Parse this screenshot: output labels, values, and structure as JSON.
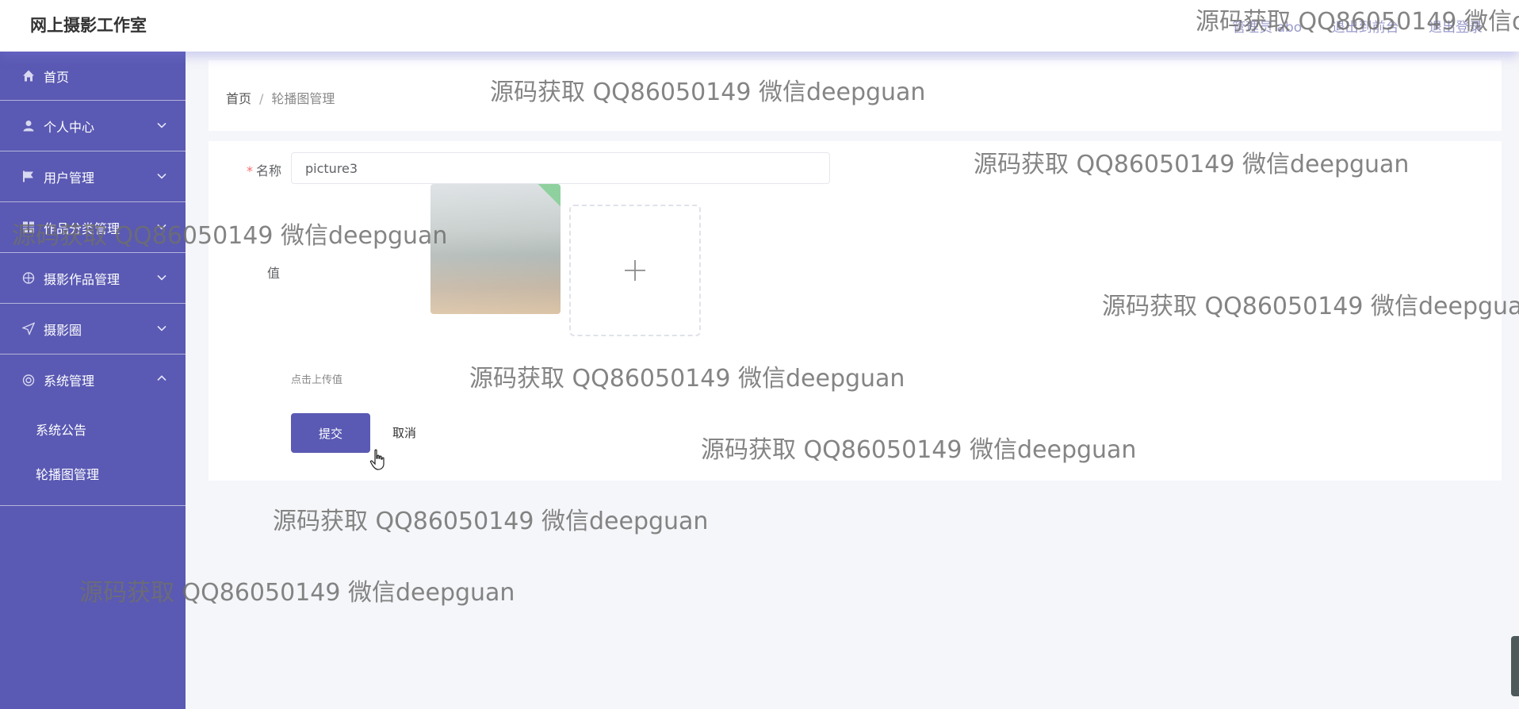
{
  "app": {
    "title": "网上摄影工作室"
  },
  "topbar": {
    "user": "管理员 abo",
    "to_front": "退出到前台",
    "logout": "退出登录"
  },
  "sidebar": {
    "items": [
      {
        "label": "首页",
        "icon": "home-icon"
      },
      {
        "label": "个人中心",
        "icon": "user-icon"
      },
      {
        "label": "用户管理",
        "icon": "flag-icon"
      },
      {
        "label": "作品分类管理",
        "icon": "grid-icon"
      },
      {
        "label": "摄影作品管理",
        "icon": "globe-icon"
      },
      {
        "label": "摄影圈",
        "icon": "send-icon"
      },
      {
        "label": "系统管理",
        "icon": "settings-icon",
        "expanded": true
      }
    ],
    "subitems": [
      "系统公告",
      "轮播图管理"
    ]
  },
  "breadcrumb": {
    "home": "首页",
    "separator": "/",
    "current": "轮播图管理"
  },
  "form": {
    "name_label": "名称",
    "name_value": "picture3",
    "value_label": "值",
    "upload_hint": "点击上传值",
    "submit": "提交",
    "cancel": "取消"
  },
  "watermark": "源码获取 QQ86050149 微信deepguan",
  "colors": {
    "accent": "#5a59b3",
    "required": "#f56c6c"
  }
}
